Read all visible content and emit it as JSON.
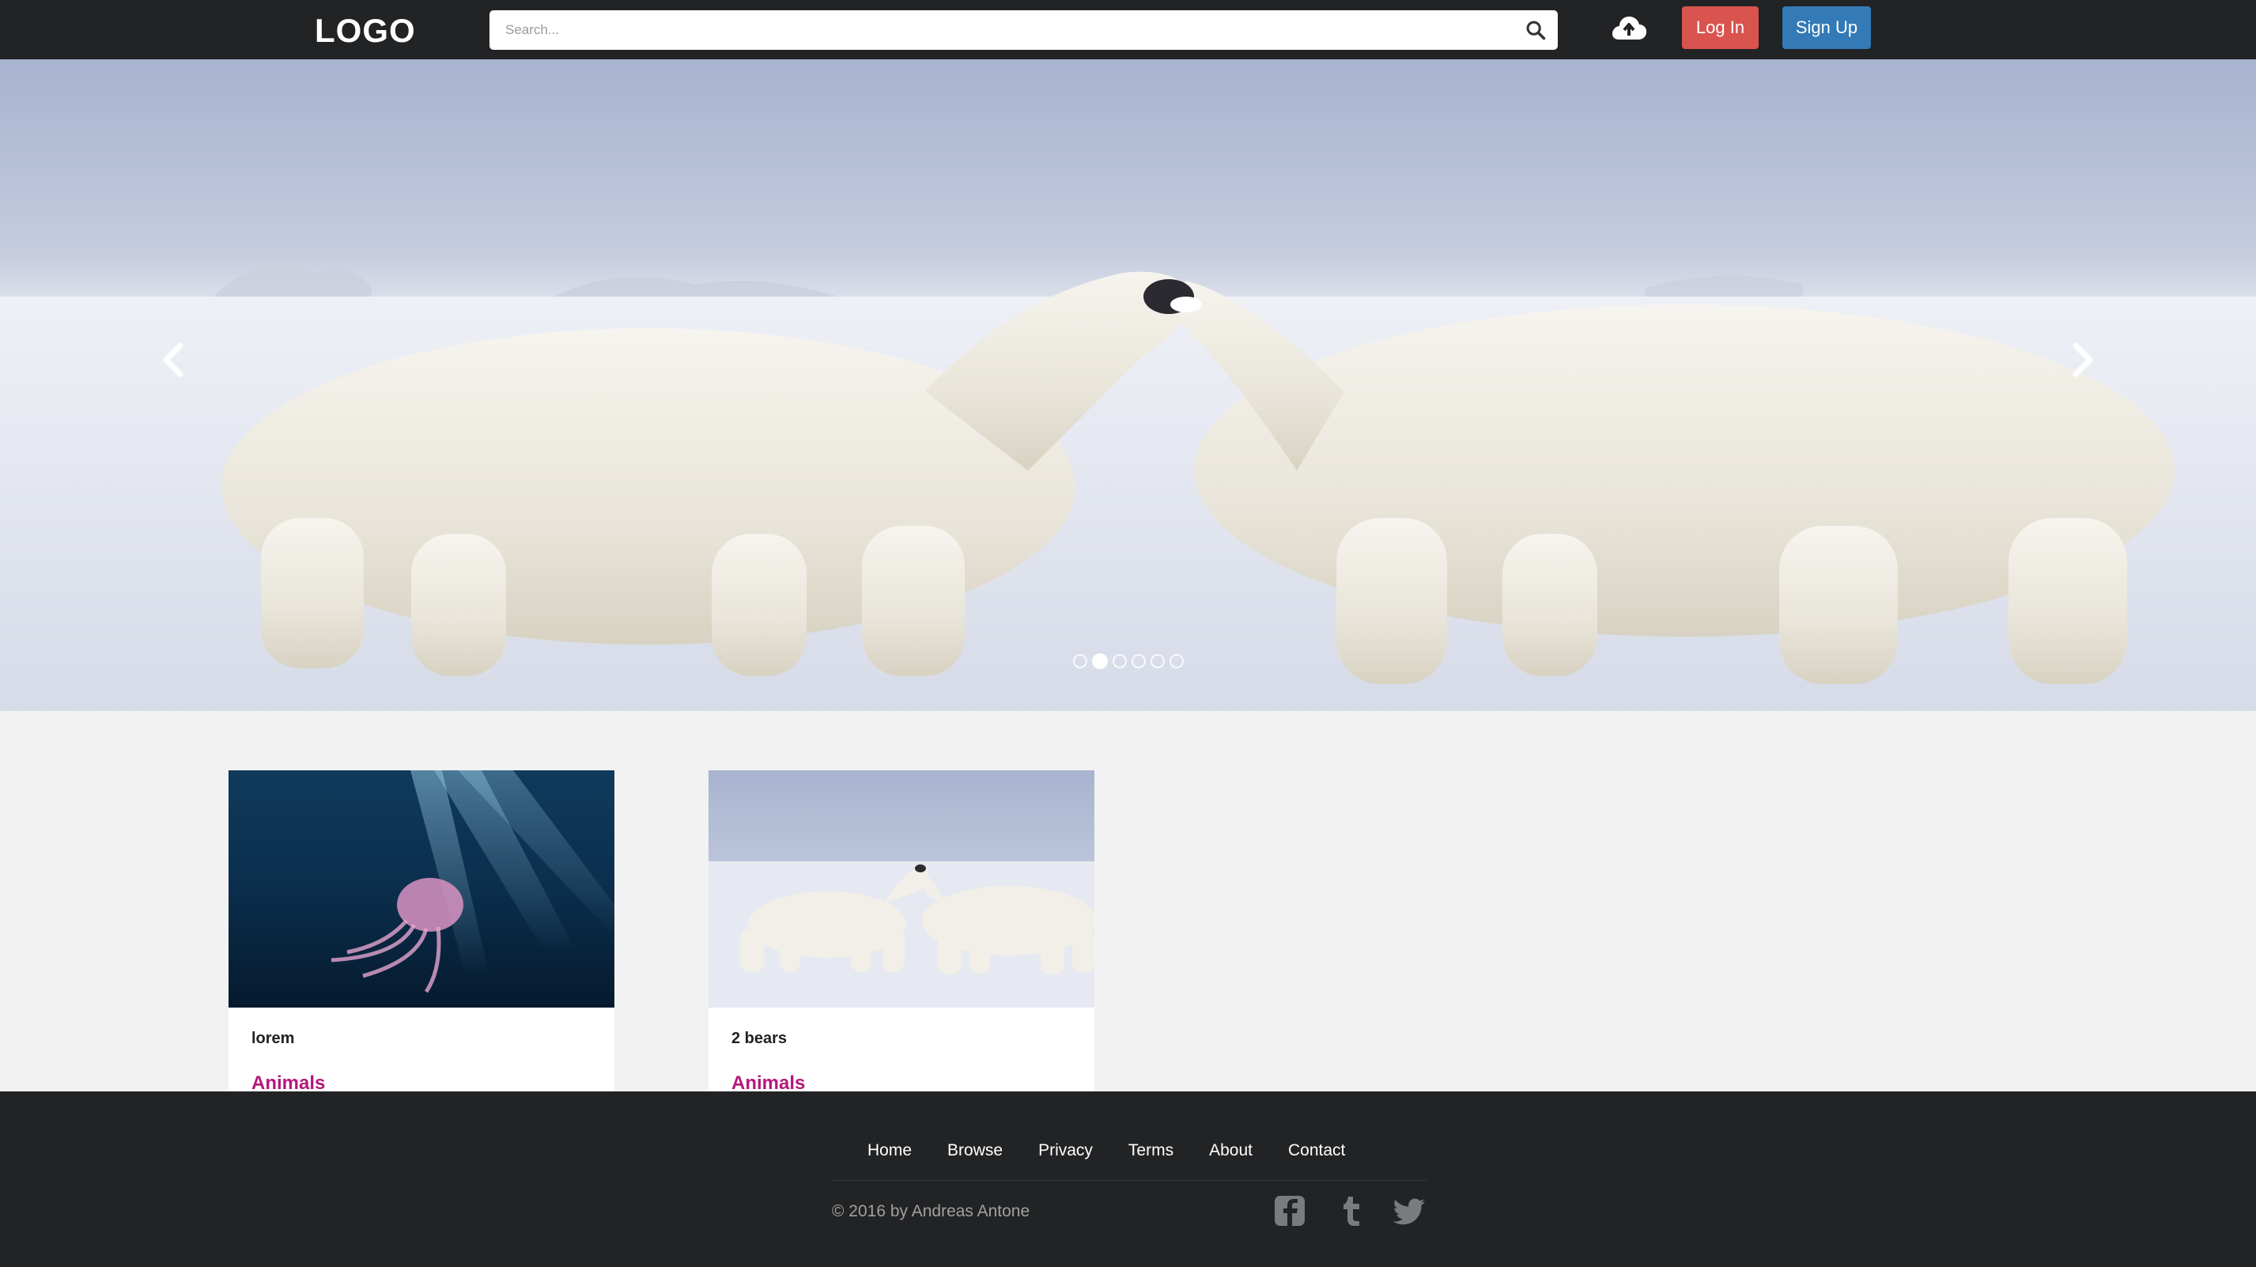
{
  "header": {
    "logo": "LOGO",
    "search_placeholder": "Search...",
    "login_label": "Log In",
    "signup_label": "Sign Up",
    "icons": [
      "search-icon",
      "cloud-upload-icon"
    ]
  },
  "carousel": {
    "slide_count": 6,
    "active_index": 1,
    "icons": [
      "chevron-left-icon",
      "chevron-right-icon"
    ]
  },
  "cards": [
    {
      "title": "lorem",
      "category": "Animals",
      "image": "jellyfish"
    },
    {
      "title": "2 bears",
      "category": "Animals",
      "image": "polar-bears"
    }
  ],
  "footer": {
    "nav": [
      "Home",
      "Browse",
      "Privacy",
      "Terms",
      "About",
      "Contact"
    ],
    "copyright": "© 2016 by Andreas Antone",
    "social": [
      "facebook-icon",
      "tumblr-icon",
      "twitter-icon"
    ]
  },
  "colors": {
    "topbar": "#222325",
    "login": "#d9534f",
    "signup": "#337ab7",
    "category": "#b5177c",
    "page_bg": "#f2f2f2"
  }
}
